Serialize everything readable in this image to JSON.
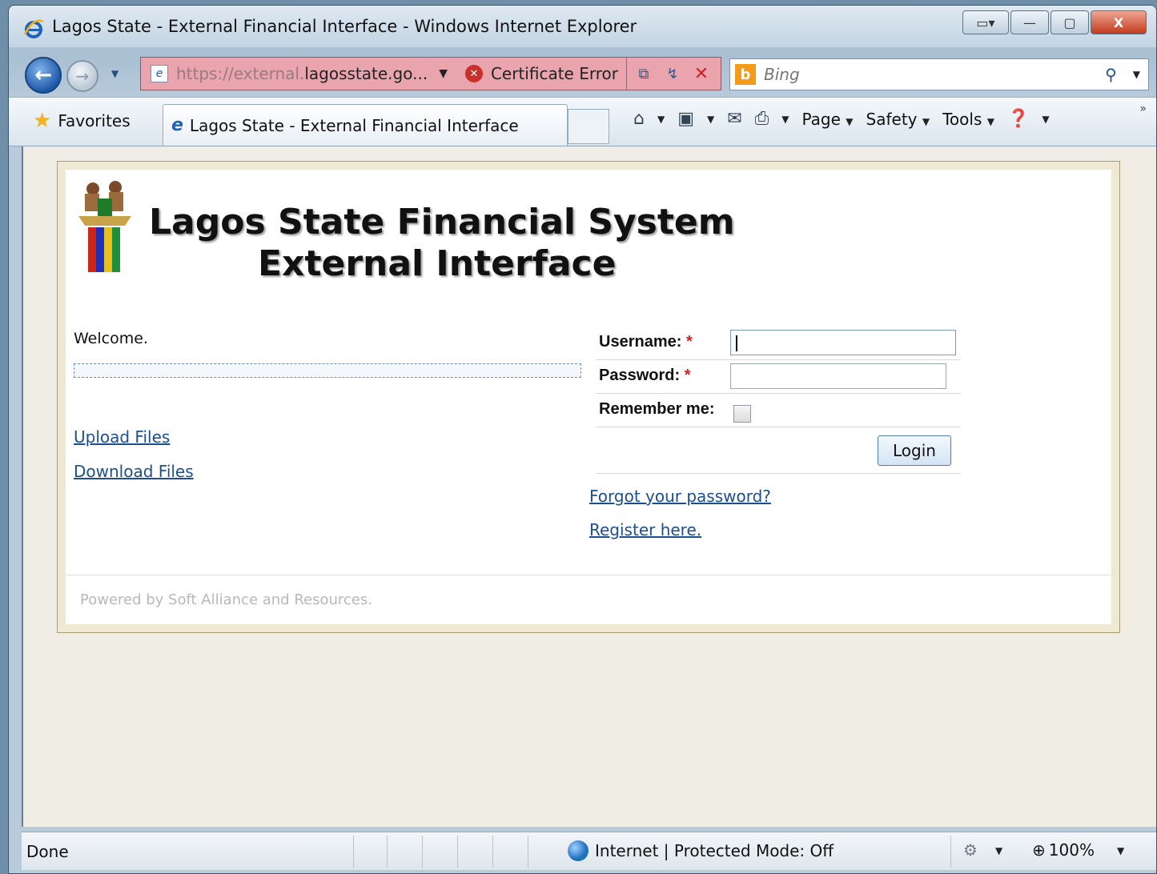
{
  "window": {
    "title": "Lagos State - External Financial Interface - Windows Internet Explorer"
  },
  "address": {
    "url_dim": "https://external.",
    "url_main": "lagosstate.go...",
    "cert_error": "Certificate Error"
  },
  "search": {
    "placeholder": "Bing"
  },
  "commandbar": {
    "favorites": "Favorites",
    "tab_label": "Lagos State - External Financial Interface",
    "page": "Page",
    "safety": "Safety",
    "tools": "Tools"
  },
  "page": {
    "heading_line1": "Lagos State Financial System",
    "heading_line2": "External Interface",
    "welcome": "Welcome.",
    "links": {
      "upload": "Upload Files",
      "download": "Download Files",
      "forgot": "Forgot your password?",
      "register": "Register here."
    },
    "login": {
      "username_label": "Username:",
      "password_label": "Password:",
      "remember_label": "Remember me:",
      "required_mark": "*",
      "username_value": "",
      "password_value": "",
      "remember_checked": false,
      "button": "Login"
    },
    "footer": "Powered by Soft Alliance and Resources."
  },
  "statusbar": {
    "status": "Done",
    "zone": "Internet | Protected Mode: Off",
    "zoom": "100%"
  },
  "icons": {
    "accent": "#1e63b8",
    "error": "#c9302c",
    "link": "#1d4f8f"
  }
}
